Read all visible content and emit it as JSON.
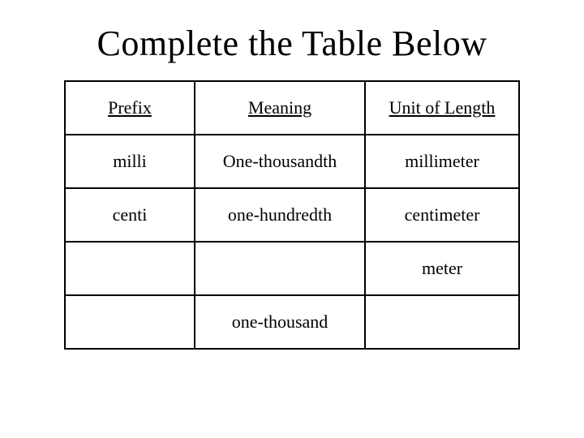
{
  "title": "Complete the Table Below",
  "headers": {
    "col1": "Prefix",
    "col2": "Meaning",
    "col3": "Unit of Length"
  },
  "rows": [
    {
      "prefix": "milli",
      "meaning": "One-thousandth",
      "unit": "millimeter"
    },
    {
      "prefix": "centi",
      "meaning": "one-hundredth",
      "unit": "centimeter"
    },
    {
      "prefix": "",
      "meaning": "",
      "unit": "meter"
    },
    {
      "prefix": "",
      "meaning": "one-thousand",
      "unit": ""
    }
  ]
}
